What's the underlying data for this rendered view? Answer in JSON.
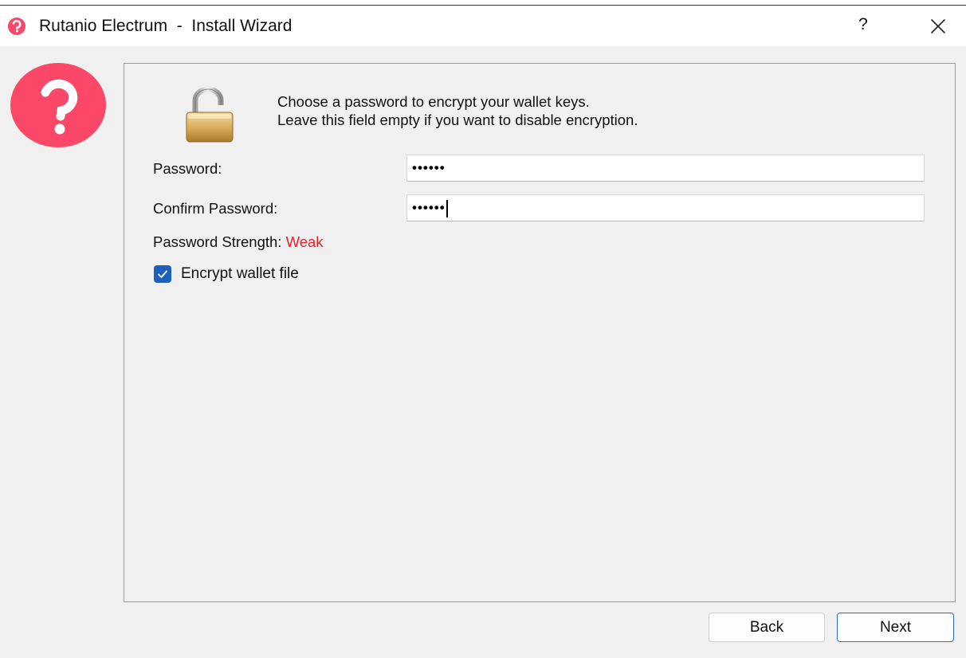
{
  "window": {
    "title": "Rutanio Electrum  -  Install Wizard",
    "help_label": "?",
    "close_icon": "close-icon"
  },
  "colors": {
    "brand_red": "#fb4868",
    "accent_blue": "#1d5fbd",
    "strength_weak": "#e8202a"
  },
  "message": {
    "line1": "Choose a password to encrypt your wallet keys.",
    "line2": "Leave this field empty if you want to disable encryption."
  },
  "form": {
    "password_label": "Password:",
    "password_value": "••••••",
    "confirm_label": "Confirm Password:",
    "confirm_value": "••••••",
    "strength_label": "Password Strength:",
    "strength_value": "Weak",
    "encrypt_checkbox_label": "Encrypt wallet file",
    "encrypt_checked": true
  },
  "buttons": {
    "back_label": "Back",
    "next_label": "Next"
  }
}
